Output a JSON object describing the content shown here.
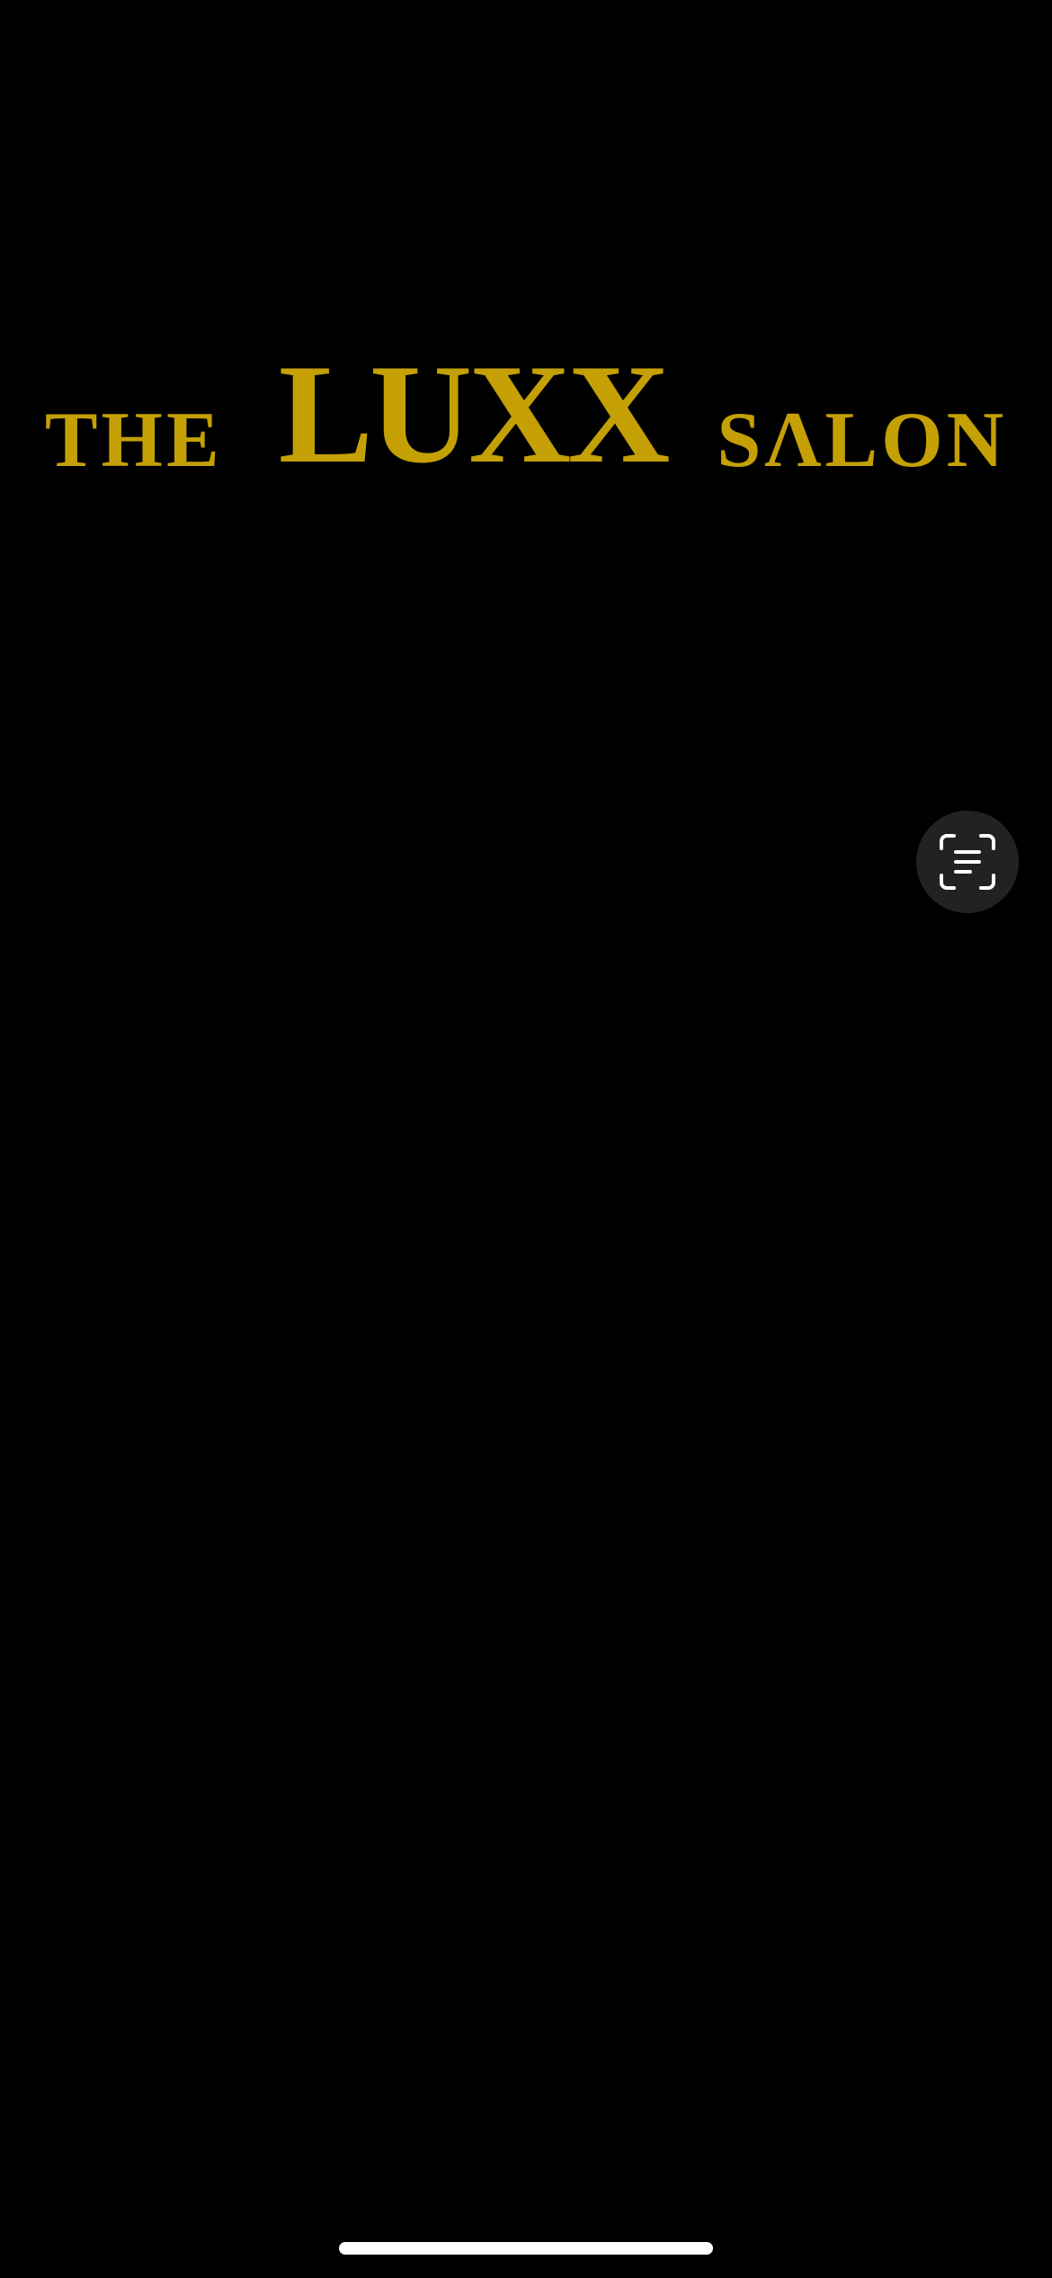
{
  "logo": {
    "prefix": "THE",
    "name": "LUXX",
    "suffix": "SΛLON",
    "color": "#C4A005"
  },
  "scan_button": {
    "icon": "live-text-scan-icon"
  },
  "home_indicator": {
    "color": "#FFFFFF"
  }
}
